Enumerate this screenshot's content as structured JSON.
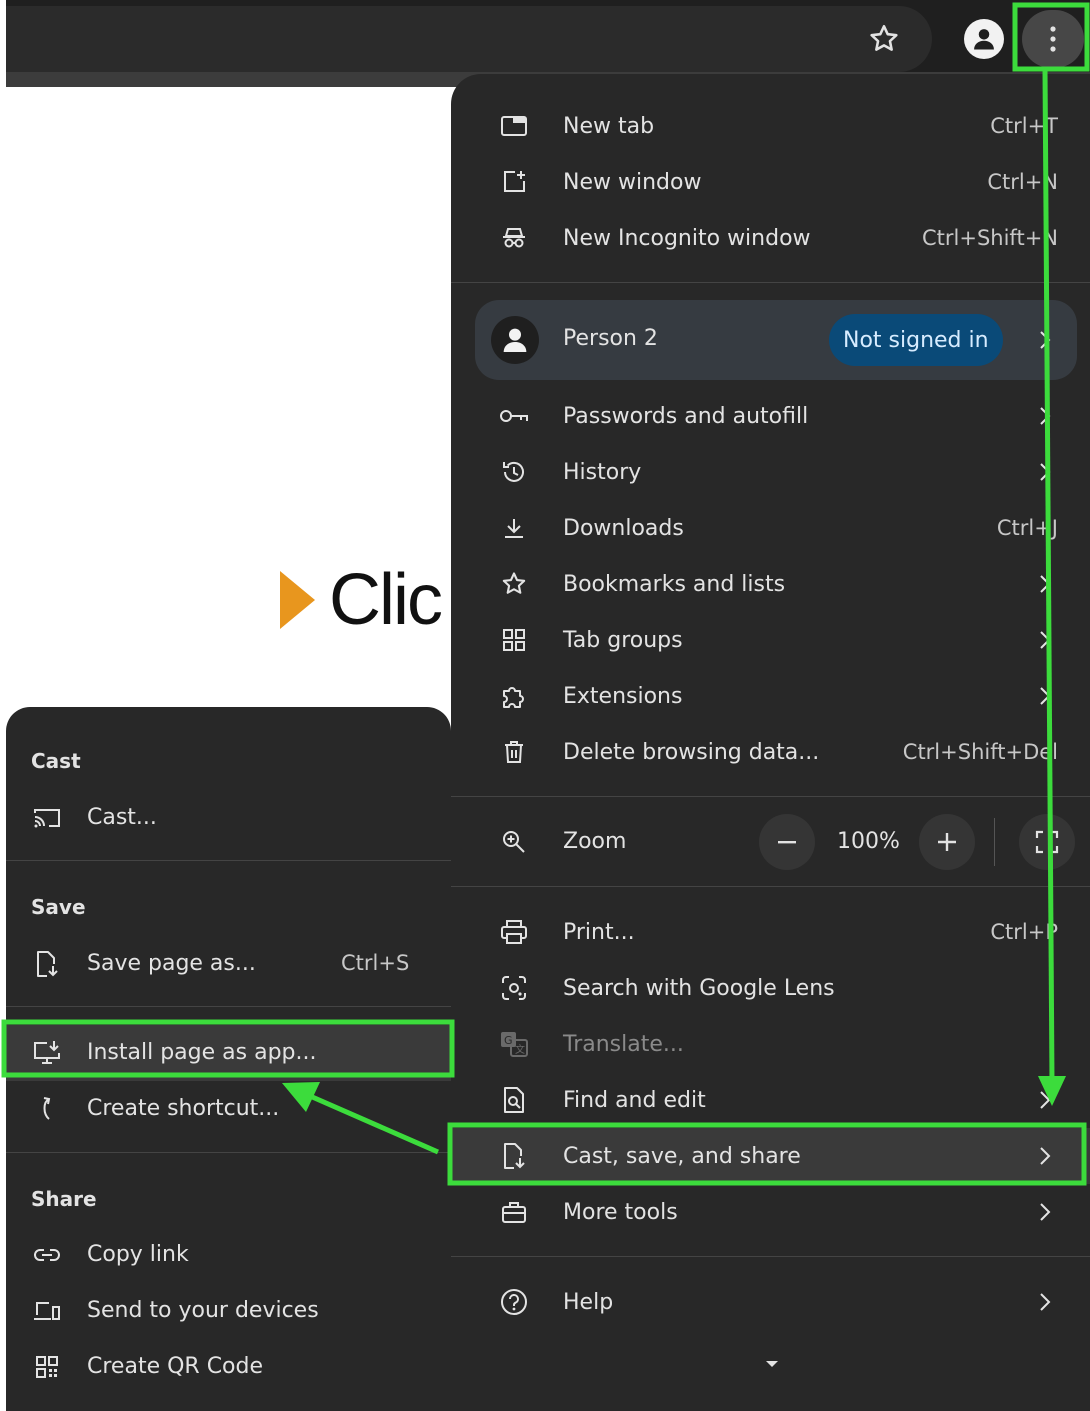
{
  "toolbar": {
    "icons": {
      "bookmark": "star-icon",
      "profile": "person-icon",
      "menu": "three-dots-vertical-icon"
    }
  },
  "page": {
    "logo_text": "Clic",
    "logo_color": "#e8961e"
  },
  "main_menu": {
    "new_tab": {
      "label": "New tab",
      "shortcut": "Ctrl+T"
    },
    "new_window": {
      "label": "New window",
      "shortcut": "Ctrl+N"
    },
    "new_incognito": {
      "label": "New Incognito window",
      "shortcut": "Ctrl+Shift+N"
    },
    "profile": {
      "name": "Person 2",
      "status": "Not signed in"
    },
    "passwords": {
      "label": "Passwords and autofill"
    },
    "history": {
      "label": "History"
    },
    "downloads": {
      "label": "Downloads",
      "shortcut": "Ctrl+J"
    },
    "bookmarks": {
      "label": "Bookmarks and lists"
    },
    "tab_groups": {
      "label": "Tab groups"
    },
    "extensions": {
      "label": "Extensions"
    },
    "delete_data": {
      "label": "Delete browsing data...",
      "shortcut": "Ctrl+Shift+Del"
    },
    "zoom": {
      "label": "Zoom",
      "value": "100%"
    },
    "print": {
      "label": "Print...",
      "shortcut": "Ctrl+P"
    },
    "lens": {
      "label": "Search with Google Lens"
    },
    "translate": {
      "label": "Translate..."
    },
    "find_edit": {
      "label": "Find and edit"
    },
    "cast_save_share": {
      "label": "Cast, save, and share"
    },
    "more_tools": {
      "label": "More tools"
    },
    "help": {
      "label": "Help"
    }
  },
  "sub_menu": {
    "cast_header": "Cast",
    "cast": {
      "label": "Cast..."
    },
    "save_header": "Save",
    "save_page": {
      "label": "Save page as...",
      "shortcut": "Ctrl+S"
    },
    "install_app": {
      "label": "Install page as app..."
    },
    "create_shortcut": {
      "label": "Create shortcut..."
    },
    "share_header": "Share",
    "copy_link": {
      "label": "Copy link"
    },
    "send_devices": {
      "label": "Send to your devices"
    },
    "qr_code": {
      "label": "Create QR Code"
    }
  },
  "colors": {
    "menu_bg": "#282828",
    "annotation_green": "#3cdc3c",
    "badge_bg": "#0a4a78"
  }
}
